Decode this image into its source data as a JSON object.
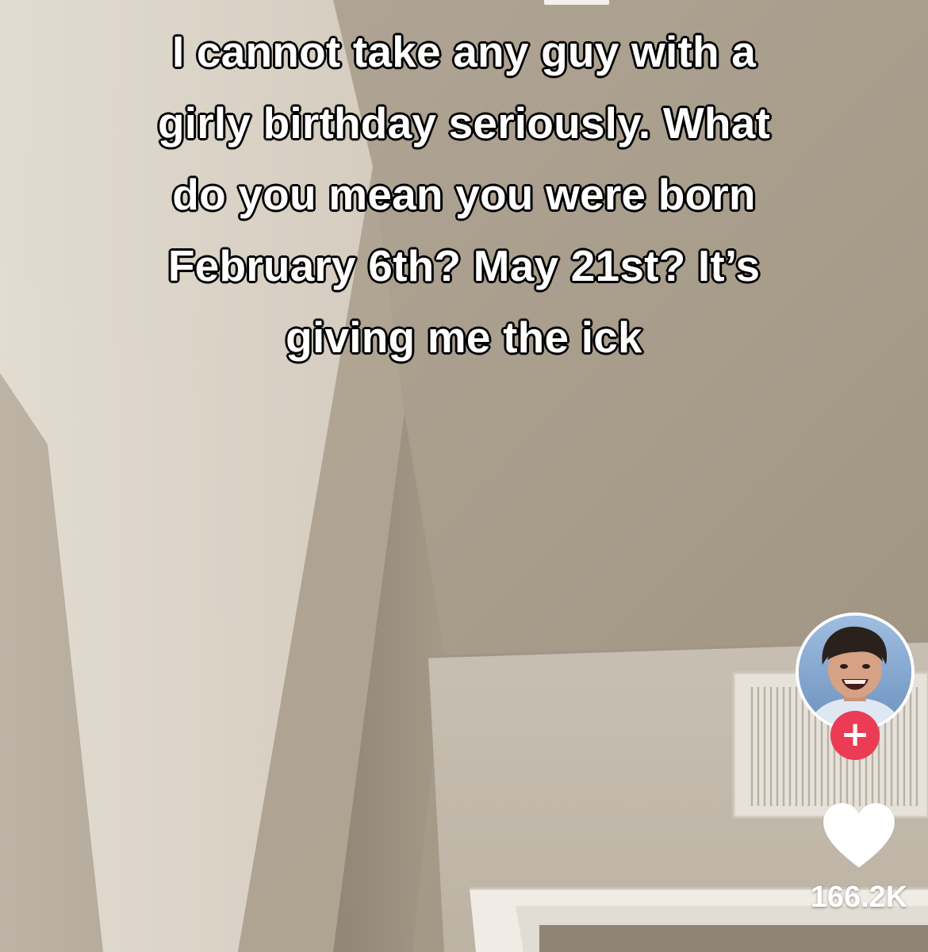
{
  "caption": {
    "lines": [
      "I cannot take any guy with a",
      "girly birthday seriously. What",
      "do you mean you were born",
      "February 6th? May 21st? It’s",
      "giving me the ick"
    ]
  },
  "sidebar": {
    "profile": {
      "avatar_icon": "creator-avatar",
      "follow_label": "+"
    },
    "like": {
      "icon": "heart-icon",
      "count": "166.2K"
    }
  },
  "colors": {
    "follow_accent": "#ec3b55",
    "caption_text": "#ffffff",
    "caption_outline": "#111111"
  }
}
